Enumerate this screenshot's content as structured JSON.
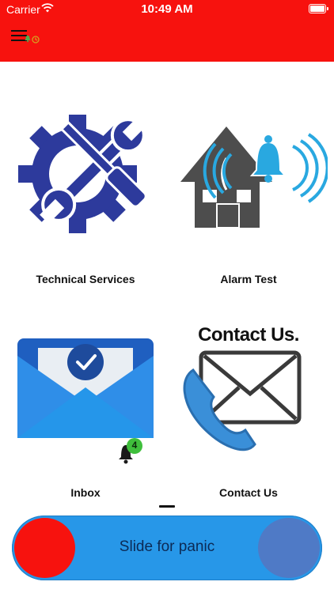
{
  "status_bar": {
    "carrier": "Carrier",
    "time": "10:49 AM",
    "wifi_icon": "wifi-icon",
    "battery_icon": "battery-full-icon"
  },
  "header": {
    "background": "#f7120e",
    "menu_icon": "hamburger-menu-icon"
  },
  "tiles": [
    {
      "label": "Technical Services",
      "icon": "gear-wrench-screwdriver-icon"
    },
    {
      "label": "Alarm Test",
      "icon": "house-alarm-bell-icon"
    },
    {
      "label": "Inbox",
      "icon": "envelope-check-icon",
      "badge": "4"
    },
    {
      "label": "Contact Us",
      "icon": "contact-us-phone-envelope-icon",
      "banner": "Contact Us."
    }
  ],
  "panic_slider": {
    "label": "Slide for panic",
    "knob_color": "#f7120e",
    "track_color": "#2797e8",
    "end_color": "#4f7ac6"
  }
}
